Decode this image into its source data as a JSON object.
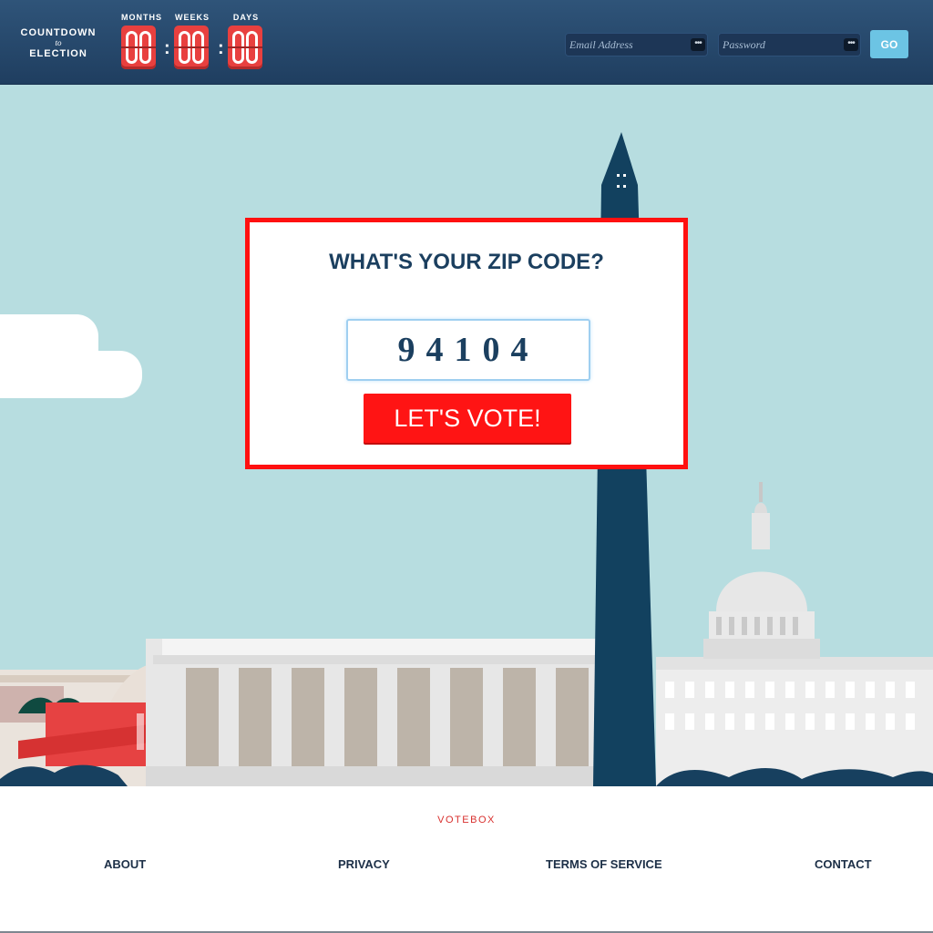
{
  "header": {
    "brand": {
      "line1": "COUNTDOWN",
      "line2": "to",
      "line3": "ELECTION"
    },
    "countdown": [
      {
        "label": "MONTHS",
        "value": "00"
      },
      {
        "label": "WEEKS",
        "value": "00"
      },
      {
        "label": "DAYS",
        "value": "00"
      }
    ],
    "email_placeholder": "Email Address",
    "password_placeholder": "Password",
    "key_icon_glyph": "•••",
    "go_label": "GO"
  },
  "zip_card": {
    "title": "WHAT'S YOUR ZIP CODE?",
    "zip_value": "94104",
    "button_label": "LET'S VOTE!"
  },
  "footer": {
    "brand": "VOTEBOX",
    "links": [
      "ABOUT",
      "PRIVACY",
      "TERMS OF SERVICE",
      "CONTACT"
    ]
  },
  "colors": {
    "header_bg": "#24466b",
    "sky": "#b7dde0",
    "accent_red": "#ff1414",
    "navy": "#1b3f5f",
    "go_button": "#6cc4e4"
  }
}
